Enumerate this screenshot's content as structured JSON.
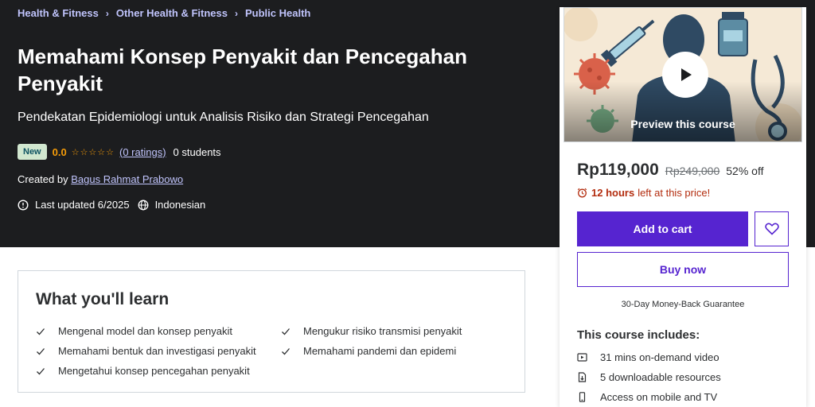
{
  "breadcrumb": [
    "Health & Fitness",
    "Other Health & Fitness",
    "Public Health"
  ],
  "course": {
    "title": "Memahami Konsep Penyakit dan Pencegahan Penyakit",
    "subtitle": "Pendekatan Epidemiologi untuk Analisis Risiko dan Strategi Pencegahan",
    "badge": "New",
    "rating": "0.0",
    "stars_filled": 0,
    "stars_total": 5,
    "ratings_text": "(0 ratings)",
    "students_text": "0 students",
    "created_by_label": "Created by",
    "instructor": "Bagus Rahmat Prabowo",
    "last_updated": "Last updated 6/2025",
    "language": "Indonesian"
  },
  "learn": {
    "title": "What you'll learn",
    "items": [
      "Mengenal model dan konsep penyakit",
      "Mengukur risiko transmisi penyakit",
      "Memahami bentuk dan investigasi penyakit",
      "Memahami pandemi dan epidemi",
      "Mengetahui konsep pencegahan penyakit"
    ]
  },
  "sidebar": {
    "preview_text": "Preview this course",
    "price": "Rp119,000",
    "original_price": "Rp249,000",
    "discount": "52% off",
    "timer_bold": "12 hours",
    "timer_rest": "left at this price!",
    "add_to_cart": "Add to cart",
    "buy_now": "Buy now",
    "guarantee": "30-Day Money-Back Guarantee",
    "includes_title": "This course includes:",
    "includes": [
      {
        "icon": "video-icon",
        "text": "31 mins on-demand video"
      },
      {
        "icon": "download-file-icon",
        "text": "5 downloadable resources"
      },
      {
        "icon": "mobile-icon",
        "text": "Access on mobile and TV"
      }
    ]
  },
  "colors": {
    "hero_bg": "#1c1d1f",
    "accent": "#5624d0",
    "link": "#c0c4fc",
    "star": "#f69c08",
    "timer": "#b32d0f"
  }
}
